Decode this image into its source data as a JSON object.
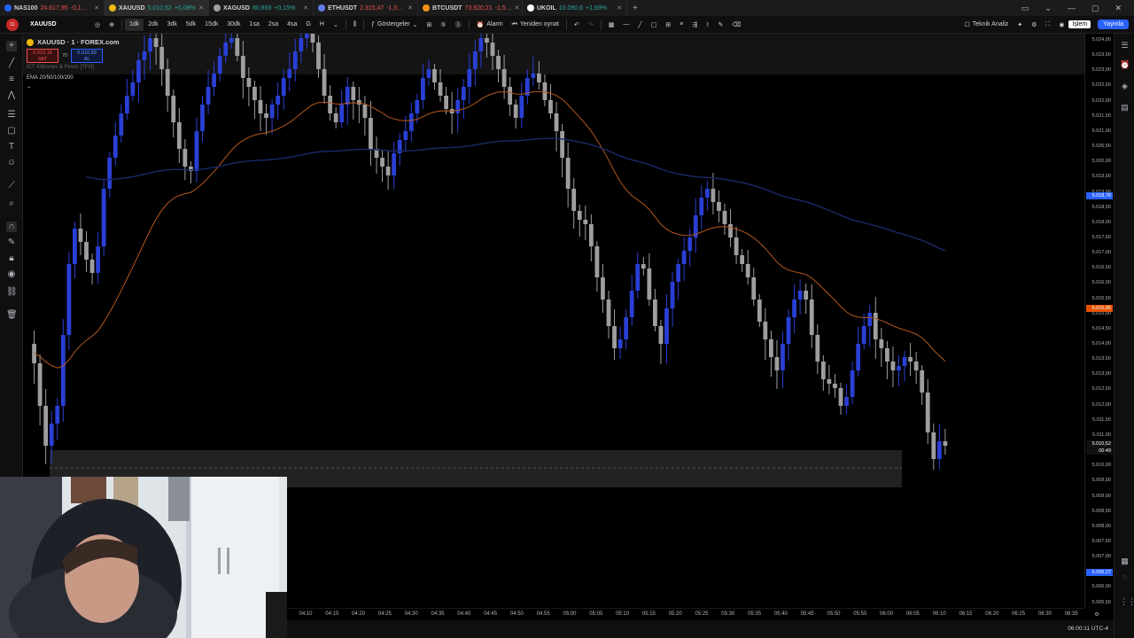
{
  "tabs": [
    {
      "symbol": "NAS100",
      "price": "24.617,95",
      "change": "-0,1…",
      "dir": "down",
      "color": "#2962ff"
    },
    {
      "symbol": "XAUUSD",
      "price": "5.010,52",
      "change": "+0,08%",
      "dir": "up",
      "color": "#f0b90b"
    },
    {
      "symbol": "XAGUSD",
      "price": "80,869",
      "change": "+0,15%",
      "dir": "up",
      "color": "#9e9e9e"
    },
    {
      "symbol": "ETHUSDT",
      "price": "2.315,47",
      "change": "-1,5…",
      "dir": "down",
      "color": "#627eea"
    },
    {
      "symbol": "BTCUSDT",
      "price": "73.920,21",
      "change": "-1,5…",
      "dir": "down",
      "color": "#f7931a"
    },
    {
      "symbol": "UKOIL",
      "price": "10.090,6",
      "change": "+1,69%",
      "dir": "up",
      "color": "#ffffff"
    }
  ],
  "toolbar": {
    "symbol": "XAUUSD",
    "intervals": [
      "1dk",
      "2dk",
      "3dk",
      "5dk",
      "15dk",
      "30dk",
      "1sa",
      "2sa",
      "4sa",
      "G",
      "H"
    ],
    "active_interval": "1dk",
    "indicators": "Göstergeler",
    "alarm": "Alarm",
    "replay": "Yeniden oynat",
    "analysis": "Teknik Analiz",
    "trade": "İşlem",
    "publish": "Yayınla"
  },
  "legend": {
    "title": "XAUUSD · 1 · FOREX.com",
    "bid_price": "5.010,19",
    "bid_label": "SAT",
    "spread": "70",
    "ask_price": "5.010,89",
    "ask_label": "AL",
    "indicator1": "ICT Killzones & Pivots [TFO]",
    "indicator2": "EMA 20/50/100/200"
  },
  "price_axis": {
    "labels": [
      "5.024,00",
      "5.023,50",
      "5.023,00",
      "5.022,50",
      "5.022,00",
      "5.021,50",
      "5.021,00",
      "5.020,50",
      "5.020,00",
      "5.019,50",
      "5.019,00",
      "5.018,50",
      "5.018,00",
      "5.017,50",
      "5.017,00",
      "5.016,50",
      "5.016,00",
      "5.015,50",
      "5.015,00",
      "5.014,50",
      "5.014,00",
      "5.013,50",
      "5.013,00",
      "5.012,50",
      "5.012,00",
      "5.011,50",
      "5.011,00",
      "5.010,50",
      "5.010,00",
      "5.009,50",
      "5.009,00",
      "5.008,50",
      "5.008,00",
      "5.007,50",
      "5.007,00",
      "5.006,50",
      "5.006,00",
      "5.005,50"
    ],
    "tag_ema_blue": "5.018,78",
    "tag_ema_orange": "5.015,06",
    "tag_last": "5.010,52",
    "tag_countdown": "00:49",
    "tag_low": "5.006,27"
  },
  "time_axis": [
    "04:10",
    "04:15",
    "04:20",
    "04:25",
    "04:30",
    "04:35",
    "04:40",
    "04:45",
    "04:50",
    "04:55",
    "05:00",
    "05:05",
    "05:10",
    "05:15",
    "05:20",
    "05:25",
    "05:30",
    "05:35",
    "05:40",
    "05:45",
    "05:50",
    "05:55",
    "06:00",
    "06:05",
    "06:10",
    "06:15",
    "06:20",
    "06:25",
    "06:30",
    "06:35"
  ],
  "status": {
    "clock": "06:00:11 UTC-4"
  },
  "colors": {
    "up": "#2a3fd4",
    "down": "#9e9e9e",
    "ema_orange": "#b4581c",
    "ema_blue": "#1a2a6a",
    "zone": "#262626"
  }
}
